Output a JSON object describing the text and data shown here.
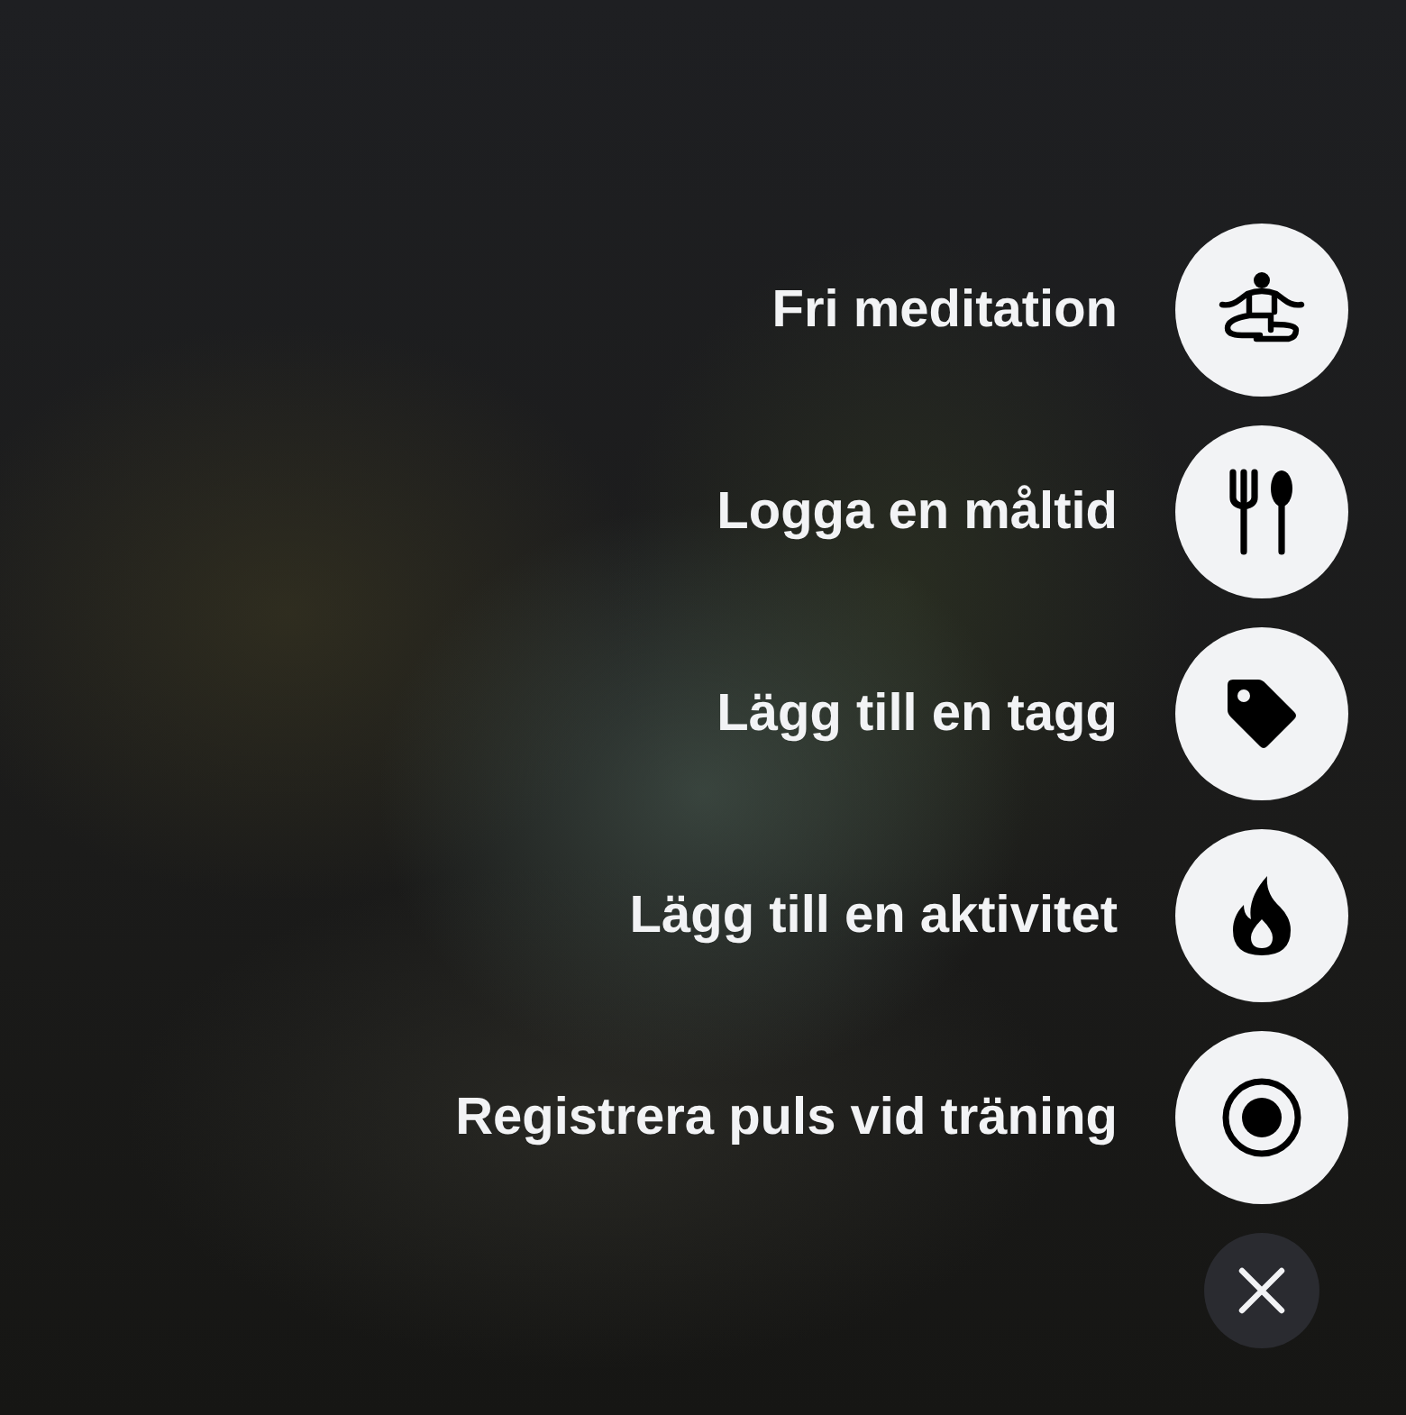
{
  "actions": [
    {
      "label": "Fri meditation",
      "kind": "meditation"
    },
    {
      "label": "Logga en måltid",
      "kind": "meal"
    },
    {
      "label": "Lägg till en tagg",
      "kind": "tag"
    },
    {
      "label": "Lägg till en aktivitet",
      "kind": "activity"
    },
    {
      "label": "Registrera puls vid träning",
      "kind": "pulse"
    }
  ],
  "close_button": {
    "kind": "close"
  }
}
